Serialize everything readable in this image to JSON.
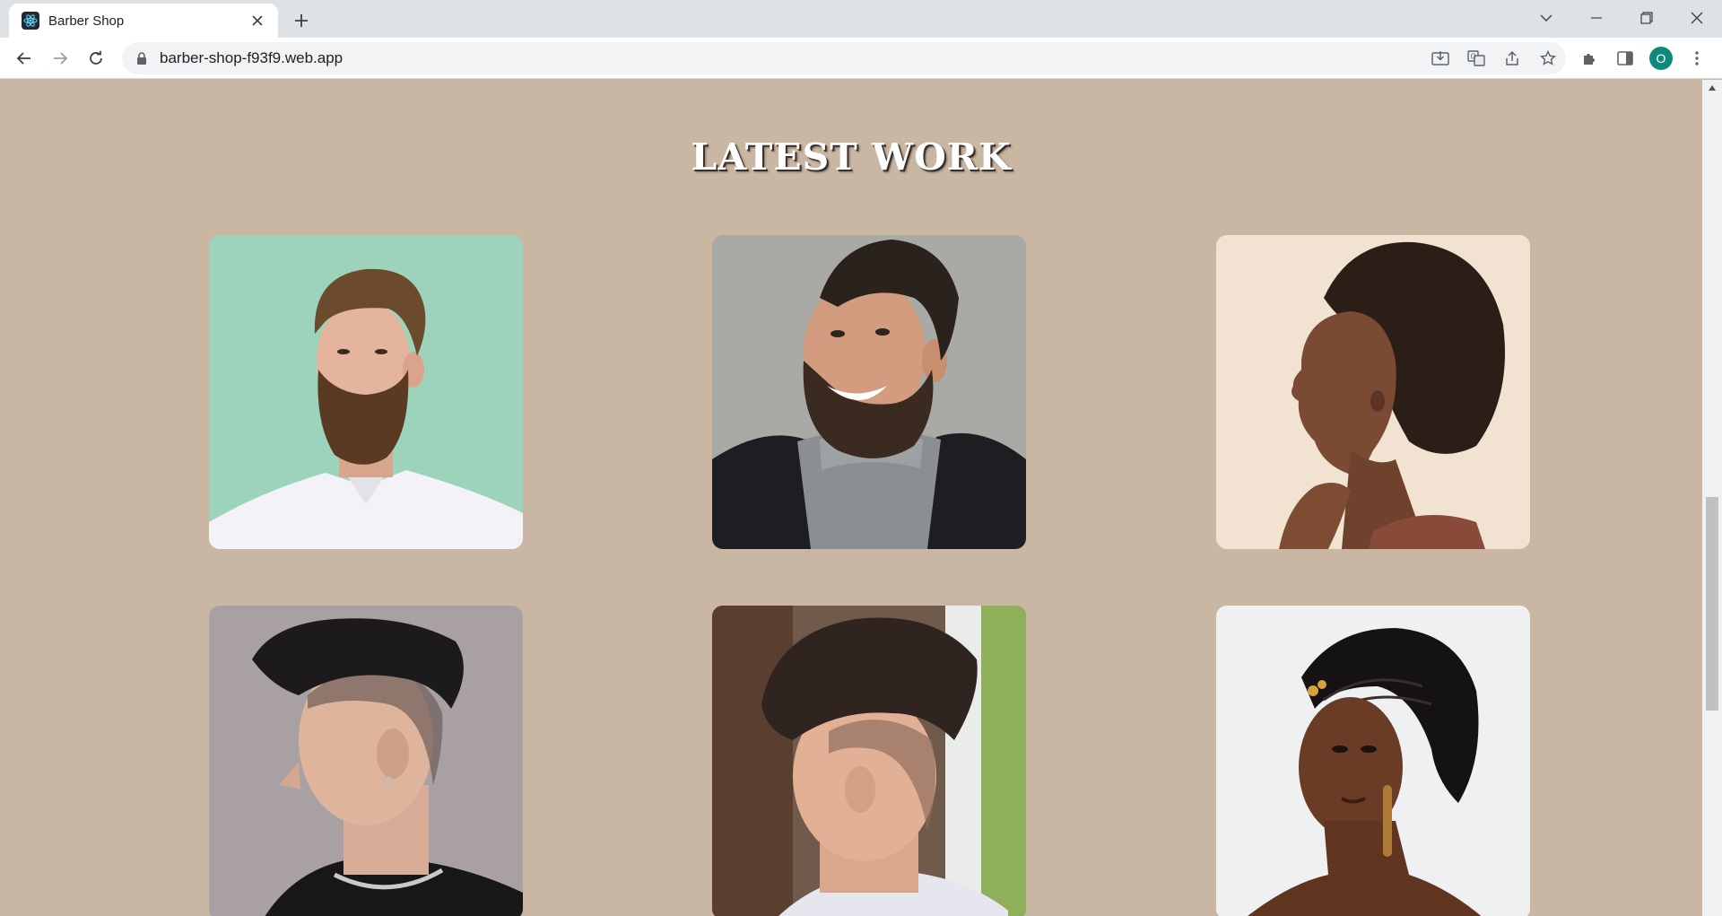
{
  "browser": {
    "tab_title": "Barber Shop",
    "url": "barber-shop-f93f9.web.app",
    "profile_initial": "O",
    "icons": {
      "favicon": "react-atom-icon",
      "close_tab": "close-icon",
      "new_tab": "plus-icon",
      "back": "arrow-left-icon",
      "forward": "arrow-right-icon",
      "reload": "reload-icon",
      "lock": "lock-icon",
      "install": "install-app-icon",
      "translate": "translate-icon",
      "share": "share-icon",
      "bookmark": "star-icon",
      "extensions": "puzzle-icon",
      "side_panel": "side-panel-icon",
      "menu": "kebab-menu-icon"
    }
  },
  "page": {
    "section_title": "LATEST WORK",
    "background_color": "#c9b6a3",
    "gallery": [
      {
        "name": "bearded-man-mint-background"
      },
      {
        "name": "smiling-bearded-man-turtleneck"
      },
      {
        "name": "woman-afro-profile"
      },
      {
        "name": "man-textured-crop-fade"
      },
      {
        "name": "man-quiff-low-fade"
      },
      {
        "name": "woman-braided-updo"
      }
    ]
  },
  "scrollbar": {
    "position_fraction": 0.5
  }
}
